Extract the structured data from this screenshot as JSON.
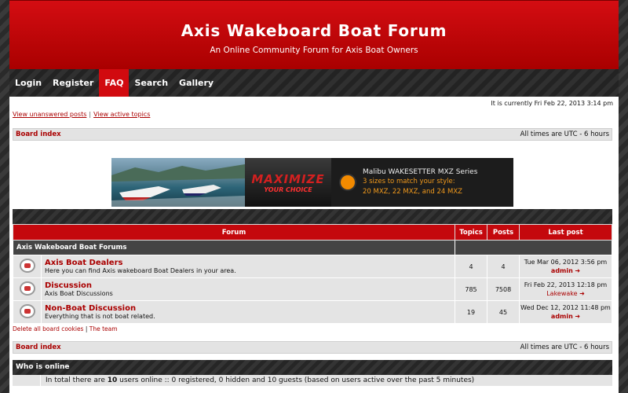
{
  "header": {
    "title": "Axis Wakeboard Boat Forum",
    "subtitle": "An Online Community Forum for Axis Boat Owners"
  },
  "nav": [
    {
      "label": "Login"
    },
    {
      "label": "Register"
    },
    {
      "label": "FAQ",
      "active": true
    },
    {
      "label": "Search"
    },
    {
      "label": "Gallery"
    }
  ],
  "current_time": "It is currently Fri Feb 22, 2013 3:14 pm",
  "links": {
    "unanswered": "View unanswered posts",
    "separator": "|",
    "active": "View active topics"
  },
  "breadcrumb": {
    "board_index": "Board index",
    "timezone": "All times are UTC - 6 hours"
  },
  "banner": {
    "maximize": "MAXIMIZE",
    "your_choice": "YOUR CHOICE",
    "line1": "Malibu WAKESETTER MXZ Series",
    "line2": "3 sizes to match your style:",
    "line3": "20 MXZ, 22 MXZ, and 24 MXZ"
  },
  "table": {
    "headers": {
      "forum": "Forum",
      "topics": "Topics",
      "posts": "Posts",
      "last_post": "Last post"
    },
    "category": "Axis Wakeboard Boat Forums",
    "rows": [
      {
        "name": "Axis Boat Dealers",
        "desc": "Here you can find Axis wakeboard Boat Dealers in your area.",
        "topics": "4",
        "posts": "4",
        "last_date": "Tue Mar 06, 2012 3:56 pm",
        "last_user": "admin"
      },
      {
        "name": "Discussion",
        "desc": "Axis Boat Discussions",
        "topics": "785",
        "posts": "7508",
        "last_date": "Fri Feb 22, 2013 12:18 pm",
        "last_user": "Lakewake"
      },
      {
        "name": "Non-Boat Discussion",
        "desc": "Everything that is not boat related.",
        "topics": "19",
        "posts": "45",
        "last_date": "Wed Dec 12, 2012 11:48 pm",
        "last_user": "admin"
      }
    ]
  },
  "footer_links": {
    "delete_cookies": "Delete all board cookies",
    "separator": "|",
    "team": "The team"
  },
  "who_is_online": {
    "title": "Who is online",
    "text_prefix": "In total there are ",
    "count": "10",
    "text_suffix": " users online :: 0 registered, 0 hidden and 10 guests (based on users active over the past 5 minutes)"
  },
  "colors": {
    "accent": "#c4080d",
    "link": "#aa0000"
  }
}
